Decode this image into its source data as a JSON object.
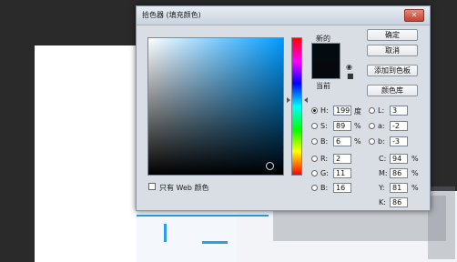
{
  "dialog": {
    "title": "拾色器 (填充颜色)",
    "close_glyph": "✕",
    "new_label": "新的",
    "current_label": "当前",
    "web_only_label": "只有 Web 颜色",
    "buttons": {
      "ok": "确定",
      "cancel": "取消",
      "add_swatch": "添加到色板",
      "libraries": "颜色库"
    },
    "hsb": {
      "h_label": "H:",
      "h_value": "199",
      "h_unit": "度",
      "s_label": "S:",
      "s_value": "89",
      "s_unit": "%",
      "b_label": "B:",
      "b_value": "6",
      "b_unit": "%"
    },
    "rgb": {
      "r_label": "R:",
      "r_value": "2",
      "g_label": "G:",
      "g_value": "11",
      "b_label": "B:",
      "b_value": "16"
    },
    "lab": {
      "l_label": "L:",
      "l_value": "3",
      "a_label": "a:",
      "a_value": "-2",
      "b_label": "b:",
      "b_value": "-3"
    },
    "cmyk": {
      "c_label": "C:",
      "c_value": "94",
      "c_unit": "%",
      "m_label": "M:",
      "m_value": "86",
      "m_unit": "%",
      "y_label": "Y:",
      "y_value": "81",
      "y_unit": "%",
      "k_label": "K:",
      "k_value": "86"
    },
    "colors": {
      "new_swatch": "#040b10",
      "current_swatch": "#05090d"
    }
  }
}
